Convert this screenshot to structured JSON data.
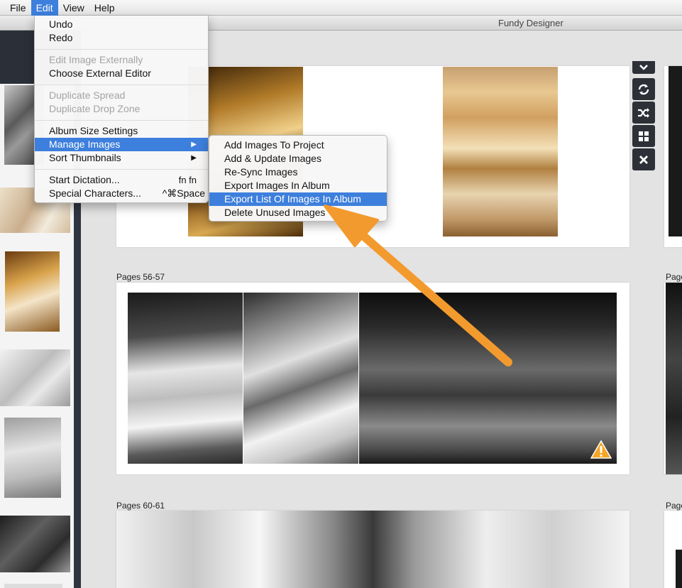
{
  "menubar": {
    "items": [
      "File",
      "Edit",
      "View",
      "Help"
    ],
    "active": "Edit"
  },
  "window": {
    "title": "Fundy Designer"
  },
  "edit_menu": {
    "undo": "Undo",
    "redo": "Redo",
    "edit_image_externally": "Edit Image Externally",
    "choose_external_editor": "Choose External Editor",
    "duplicate_spread": "Duplicate Spread",
    "duplicate_drop_zone": "Duplicate Drop Zone",
    "album_size_settings": "Album Size Settings",
    "manage_images": "Manage Images",
    "sort_thumbnails": "Sort Thumbnails",
    "start_dictation": "Start Dictation...",
    "start_dictation_shortcut": "fn fn",
    "special_characters": "Special Characters...",
    "special_characters_shortcut": "^⌘Space"
  },
  "manage_images_submenu": {
    "items": [
      "Add Images To Project",
      "Add & Update Images",
      "Re-Sync Images",
      "Export Images In Album",
      "Export List Of Images In Album",
      "Delete Unused Images"
    ],
    "highlighted": "Export List Of Images In Album"
  },
  "spreads": {
    "pages_56_57": "Pages 56-57",
    "pages_60_61": "Pages 60-61",
    "right_partial_label": "Page",
    "right_partial_label_2": "Page"
  },
  "toolbar": {
    "icons": [
      "chevron-down-icon",
      "sync-icon",
      "shuffle-icon",
      "grid-icon",
      "close-icon"
    ]
  },
  "colors": {
    "menu_highlight": "#3d7fdc",
    "annotation_arrow": "#f39a2e",
    "toolbar_bg": "#2d3037",
    "warning": "#f5a623"
  }
}
